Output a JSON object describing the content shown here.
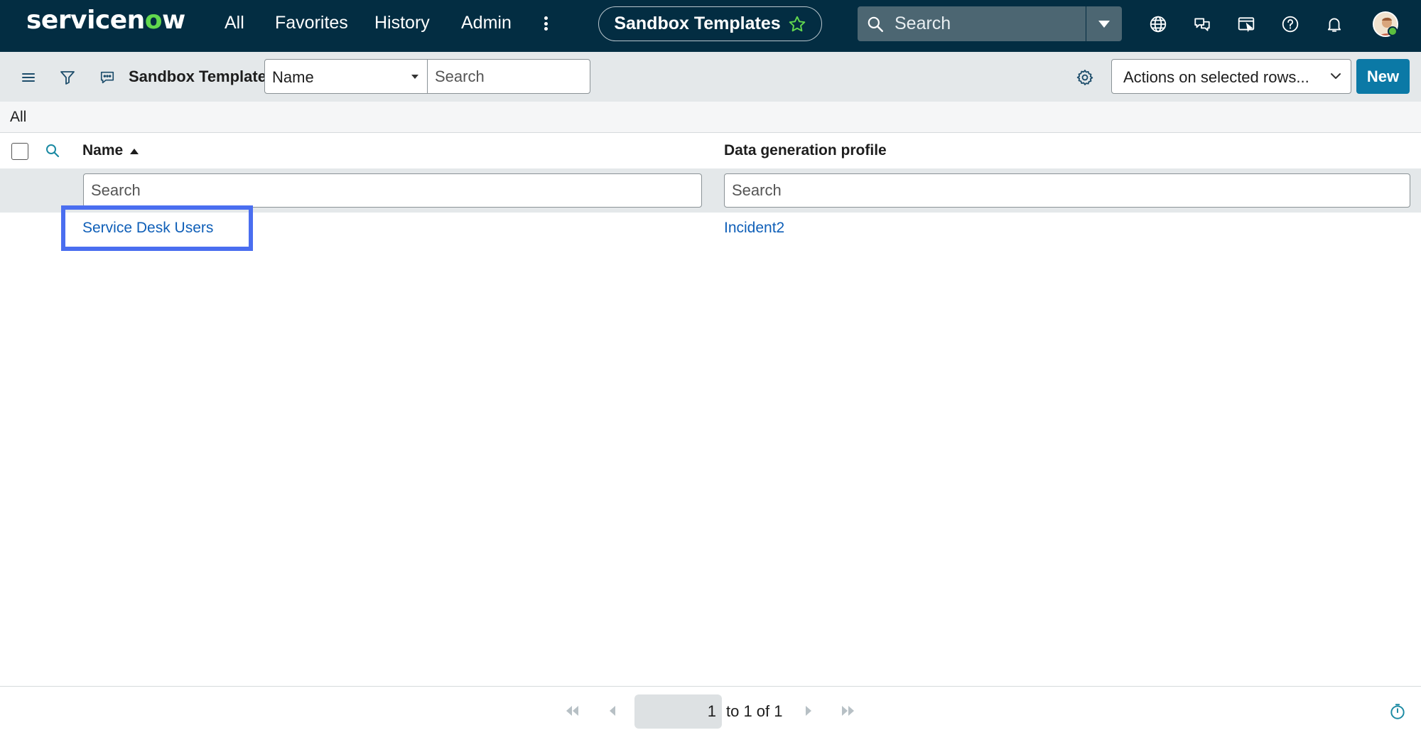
{
  "header": {
    "logo_text": "servicenow",
    "nav": [
      "All",
      "Favorites",
      "History",
      "Admin"
    ],
    "context_title": "Sandbox Templates",
    "search_placeholder": "Search"
  },
  "toolbar": {
    "list_title": "Sandbox Templates",
    "field_selected": "Name",
    "search_placeholder": "Search",
    "actions_selected": "Actions on selected rows...",
    "new_label": "New"
  },
  "breadcrumb": "All",
  "table": {
    "columns": [
      "Name",
      "Data generation profile"
    ],
    "sort": "ascending",
    "column_search_placeholder": "Search",
    "rows": [
      [
        "Service Desk Users",
        "Incident2"
      ]
    ]
  },
  "pagination": {
    "page": "1",
    "range_text": "to 1 of 1"
  },
  "colors": {
    "header_bg": "#032d42",
    "accent": "#0b79a6",
    "link": "#0f5fb8",
    "highlight": "#4a6ef0",
    "logo_o": "#62d84e"
  },
  "icons": [
    "menu-icon",
    "filter-icon",
    "comment-icon",
    "gear-icon",
    "search-icon",
    "globe-icon",
    "chat-icon",
    "screen-icon",
    "help-icon",
    "bell-icon",
    "star-icon",
    "timer-icon"
  ]
}
